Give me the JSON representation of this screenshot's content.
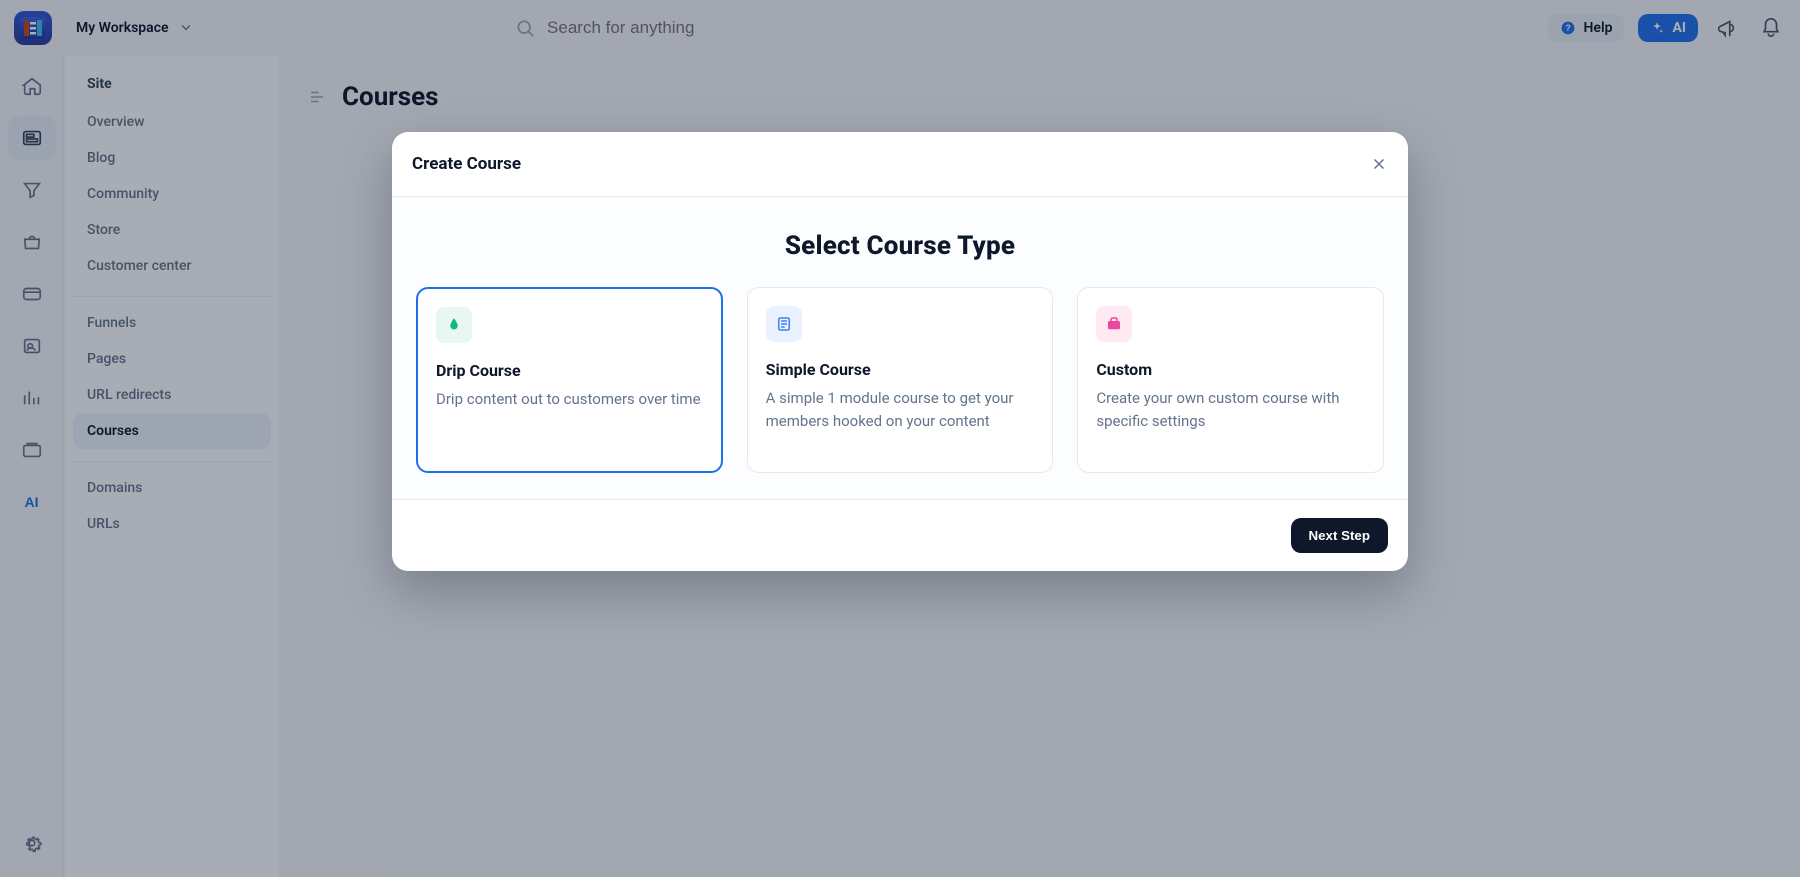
{
  "header": {
    "workspace_label": "My Workspace",
    "search_placeholder": "Search for anything",
    "help_label": "Help",
    "ai_label": "AI"
  },
  "sidebar": {
    "section1_title": "Site",
    "links1": [
      "Overview",
      "Blog",
      "Community",
      "Store",
      "Customer center"
    ],
    "links2": [
      "Funnels",
      "Pages",
      "URL redirects",
      "Courses"
    ],
    "links3": [
      "Domains",
      "URLs"
    ],
    "active_link": "Courses"
  },
  "page": {
    "title": "Courses"
  },
  "modal": {
    "title": "Create Course",
    "heading": "Select Course Type",
    "cards": [
      {
        "key": "drip",
        "title": "Drip Course",
        "desc": "Drip content out to customers over time"
      },
      {
        "key": "simple",
        "title": "Simple Course",
        "desc": "A simple 1 module course to get your members hooked on your content"
      },
      {
        "key": "custom",
        "title": "Custom",
        "desc": "Create your own custom course with specific settings"
      }
    ],
    "selected": "drip",
    "next_label": "Next Step"
  },
  "colors": {
    "brand_blue": "#1f6feb",
    "drip_green": "#10b981",
    "simple_blue": "#3b82f6",
    "custom_pink": "#ec4899"
  }
}
